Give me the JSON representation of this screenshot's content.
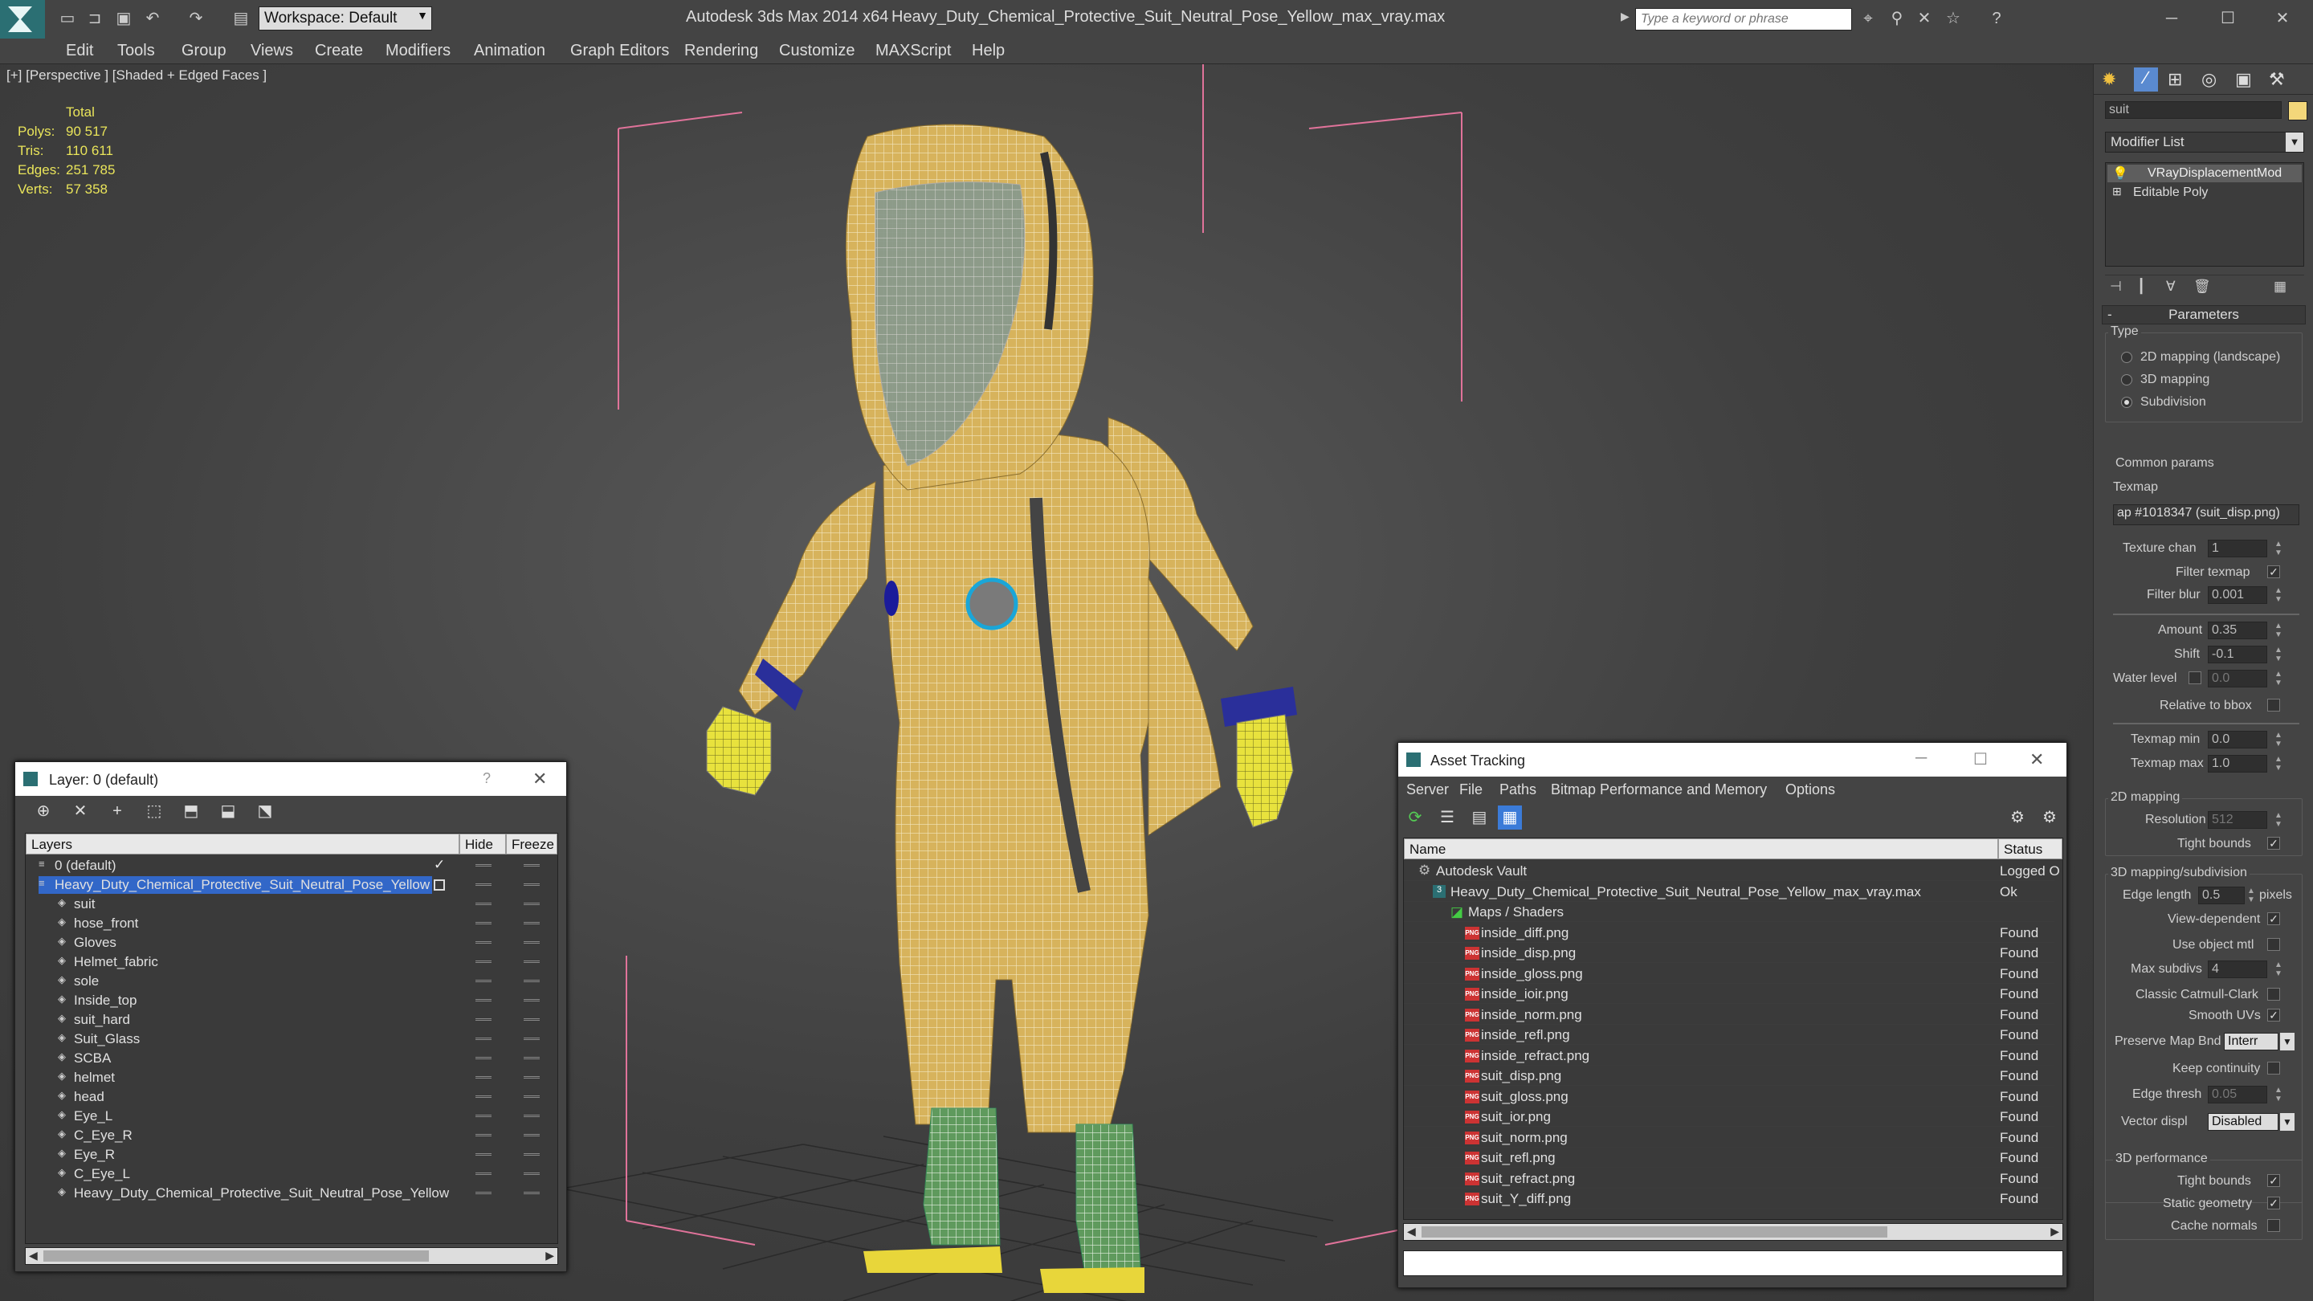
{
  "titlebar": {
    "workspace": "Workspace: Default",
    "app_title": "Autodesk 3ds Max  2014 x64",
    "file_title": "Heavy_Duty_Chemical_Protective_Suit_Neutral_Pose_Yellow_max_vray.max",
    "search_placeholder": "Type a keyword or phrase"
  },
  "menu": [
    "Edit",
    "Tools",
    "Group",
    "Views",
    "Create",
    "Modifiers",
    "Animation",
    "Graph Editors",
    "Rendering",
    "Customize",
    "MAXScript",
    "Help"
  ],
  "viewport": {
    "label": "[+] [Perspective ] [Shaded + Edged Faces ]",
    "stats": {
      "header": "Total",
      "polys_label": "Polys:",
      "polys": "90 517",
      "tris_label": "Tris:",
      "tris": "110 611",
      "edges_label": "Edges:",
      "edges": "251 785",
      "verts_label": "Verts:",
      "verts": "57 358"
    }
  },
  "command_panel": {
    "object_name": "suit",
    "modifier_list": "Modifier List",
    "stack": [
      "VRayDisplacementMod",
      "Editable Poly"
    ],
    "parameters_title": "Parameters",
    "type_group": "Type",
    "type_options": [
      "2D mapping (landscape)",
      "3D mapping",
      "Subdivision"
    ],
    "type_selected": 2,
    "common_group": "Common params",
    "texmap_label": "Texmap",
    "texmap_value": "ap #1018347 (suit_disp.png)",
    "texture_chan_label": "Texture chan",
    "texture_chan": "1",
    "filter_texmap_label": "Filter texmap",
    "filter_texmap": true,
    "filter_blur_label": "Filter blur",
    "filter_blur": "0.001",
    "amount_label": "Amount",
    "amount": "0.35",
    "shift_label": "Shift",
    "shift": "-0.1",
    "water_label": "Water level",
    "water": "0.0",
    "water_checked": false,
    "relative_label": "Relative to bbox",
    "relative": false,
    "texmap_min_label": "Texmap min",
    "texmap_min": "0.0",
    "texmap_max_label": "Texmap max",
    "texmap_max": "1.0",
    "map2d_group": "2D mapping",
    "resolution_label": "Resolution",
    "resolution": "512",
    "tight_bounds_label": "Tight bounds",
    "tight_bounds_2d": true,
    "map3d_group": "3D mapping/subdivision",
    "edge_length_label": "Edge length",
    "edge_length": "0.5",
    "pixels_label": "pixels",
    "view_dep_label": "View-dependent",
    "view_dep": true,
    "use_obj_label": "Use object mtl",
    "use_obj": false,
    "max_subdivs_label": "Max subdivs",
    "max_subdivs": "4",
    "classic_label": "Classic Catmull-Clark",
    "classic": false,
    "smooth_uvs_label": "Smooth UVs",
    "smooth_uvs": true,
    "preserve_label": "Preserve Map Bnd",
    "preserve_value": "Interr",
    "keep_cont_label": "Keep continuity",
    "keep_cont": false,
    "edge_thresh_label": "Edge thresh",
    "edge_thresh": "0.05",
    "vector_label": "Vector displ",
    "vector_value": "Disabled",
    "perf_group": "3D performance",
    "tight_bounds_3d": true,
    "static_geo_label": "Static geometry",
    "static_geo": true,
    "cache_label": "Cache normals",
    "cache": false
  },
  "layer_window": {
    "title": "Layer: 0 (default)",
    "help": "?",
    "col_layers": "Layers",
    "col_hide": "Hide",
    "col_freeze": "Freeze",
    "rows": [
      {
        "name": "0 (default)",
        "level": 0
      },
      {
        "name": "Heavy_Duty_Chemical_Protective_Suit_Neutral_Pose_Yellow",
        "level": 0,
        "selected": true
      },
      {
        "name": "suit",
        "level": 1
      },
      {
        "name": "hose_front",
        "level": 1
      },
      {
        "name": "Gloves",
        "level": 1
      },
      {
        "name": "Helmet_fabric",
        "level": 1
      },
      {
        "name": "sole",
        "level": 1
      },
      {
        "name": "Inside_top",
        "level": 1
      },
      {
        "name": "suit_hard",
        "level": 1
      },
      {
        "name": "Suit_Glass",
        "level": 1
      },
      {
        "name": "SCBA",
        "level": 1
      },
      {
        "name": "helmet",
        "level": 1
      },
      {
        "name": "head",
        "level": 1
      },
      {
        "name": "Eye_L",
        "level": 1
      },
      {
        "name": "C_Eye_R",
        "level": 1
      },
      {
        "name": "Eye_R",
        "level": 1
      },
      {
        "name": "C_Eye_L",
        "level": 1
      },
      {
        "name": "Heavy_Duty_Chemical_Protective_Suit_Neutral_Pose_Yellow",
        "level": 1
      }
    ]
  },
  "asset_window": {
    "title": "Asset Tracking",
    "menu": [
      "Server",
      "File",
      "Paths",
      "Bitmap Performance and Memory",
      "Options"
    ],
    "col_name": "Name",
    "col_status": "Status",
    "rows": [
      {
        "name": "Autodesk Vault",
        "status": "Logged O",
        "level": 0
      },
      {
        "name": "Heavy_Duty_Chemical_Protective_Suit_Neutral_Pose_Yellow_max_vray.max",
        "status": "Ok",
        "level": 1
      },
      {
        "name": "Maps / Shaders",
        "status": "",
        "level": 2
      },
      {
        "name": "inside_diff.png",
        "status": "Found",
        "level": 3
      },
      {
        "name": "inside_disp.png",
        "status": "Found",
        "level": 3
      },
      {
        "name": "inside_gloss.png",
        "status": "Found",
        "level": 3
      },
      {
        "name": "inside_ioir.png",
        "status": "Found",
        "level": 3
      },
      {
        "name": "inside_norm.png",
        "status": "Found",
        "level": 3
      },
      {
        "name": "inside_refl.png",
        "status": "Found",
        "level": 3
      },
      {
        "name": "inside_refract.png",
        "status": "Found",
        "level": 3
      },
      {
        "name": "suit_disp.png",
        "status": "Found",
        "level": 3
      },
      {
        "name": "suit_gloss.png",
        "status": "Found",
        "level": 3
      },
      {
        "name": "suit_ior.png",
        "status": "Found",
        "level": 3
      },
      {
        "name": "suit_norm.png",
        "status": "Found",
        "level": 3
      },
      {
        "name": "suit_refl.png",
        "status": "Found",
        "level": 3
      },
      {
        "name": "suit_refract.png",
        "status": "Found",
        "level": 3
      },
      {
        "name": "suit_Y_diff.png",
        "status": "Found",
        "level": 3
      }
    ],
    "png_badge": "PNG"
  }
}
